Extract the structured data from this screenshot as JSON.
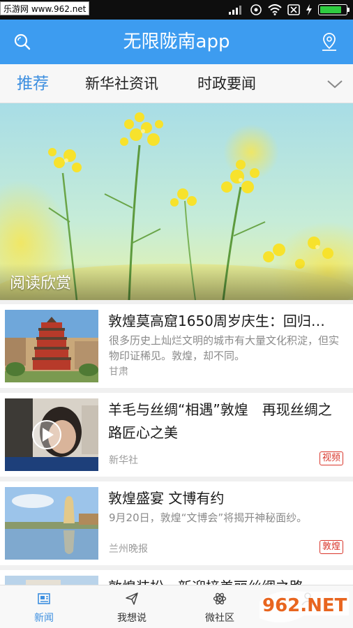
{
  "status_bar": {
    "watermark": "乐游网 www.962.net",
    "battery_level": 0.85
  },
  "header": {
    "title": "无限陇南app"
  },
  "tabs": [
    {
      "label": "推荐",
      "active": true
    },
    {
      "label": "新华社资讯",
      "active": false
    },
    {
      "label": "时政要闻",
      "active": false
    }
  ],
  "hero": {
    "caption": "阅读欣赏"
  },
  "news": [
    {
      "title": "敦煌莫高窟1650周岁庆生：回归…",
      "desc": "很多历史上灿烂文明的城市有大量文化积淀，但实物印证稀见。敦煌，却不同。",
      "source": "甘肃",
      "tag": ""
    },
    {
      "title": "羊毛与丝绸“相遇”敦煌　再现丝绸之路匠心之美",
      "desc": "",
      "source": "新华社",
      "tag": "视频"
    },
    {
      "title": "敦煌盛宴 文博有约",
      "desc": "9月20日，敦煌“文博会”将揭开神秘面纱。",
      "source": "兰州晚报",
      "tag": "敦煌"
    },
    {
      "title": "敦煌装扮　新迎接美丽丝绸之路",
      "desc": "",
      "source": "",
      "tag": ""
    }
  ],
  "bottom_nav": [
    {
      "label": "新闻",
      "icon": "news-icon",
      "active": true
    },
    {
      "label": "我想说",
      "icon": "paper-plane-icon",
      "active": false
    },
    {
      "label": "微社区",
      "icon": "atom-icon",
      "active": false
    },
    {
      "label": "",
      "icon": "user-icon",
      "active": false
    }
  ],
  "watermark_overlay": "962.NET 乐游网",
  "colors": {
    "accent": "#3d9cf0",
    "active_tab": "#3d8fe0",
    "tag_red": "#d9362b"
  }
}
